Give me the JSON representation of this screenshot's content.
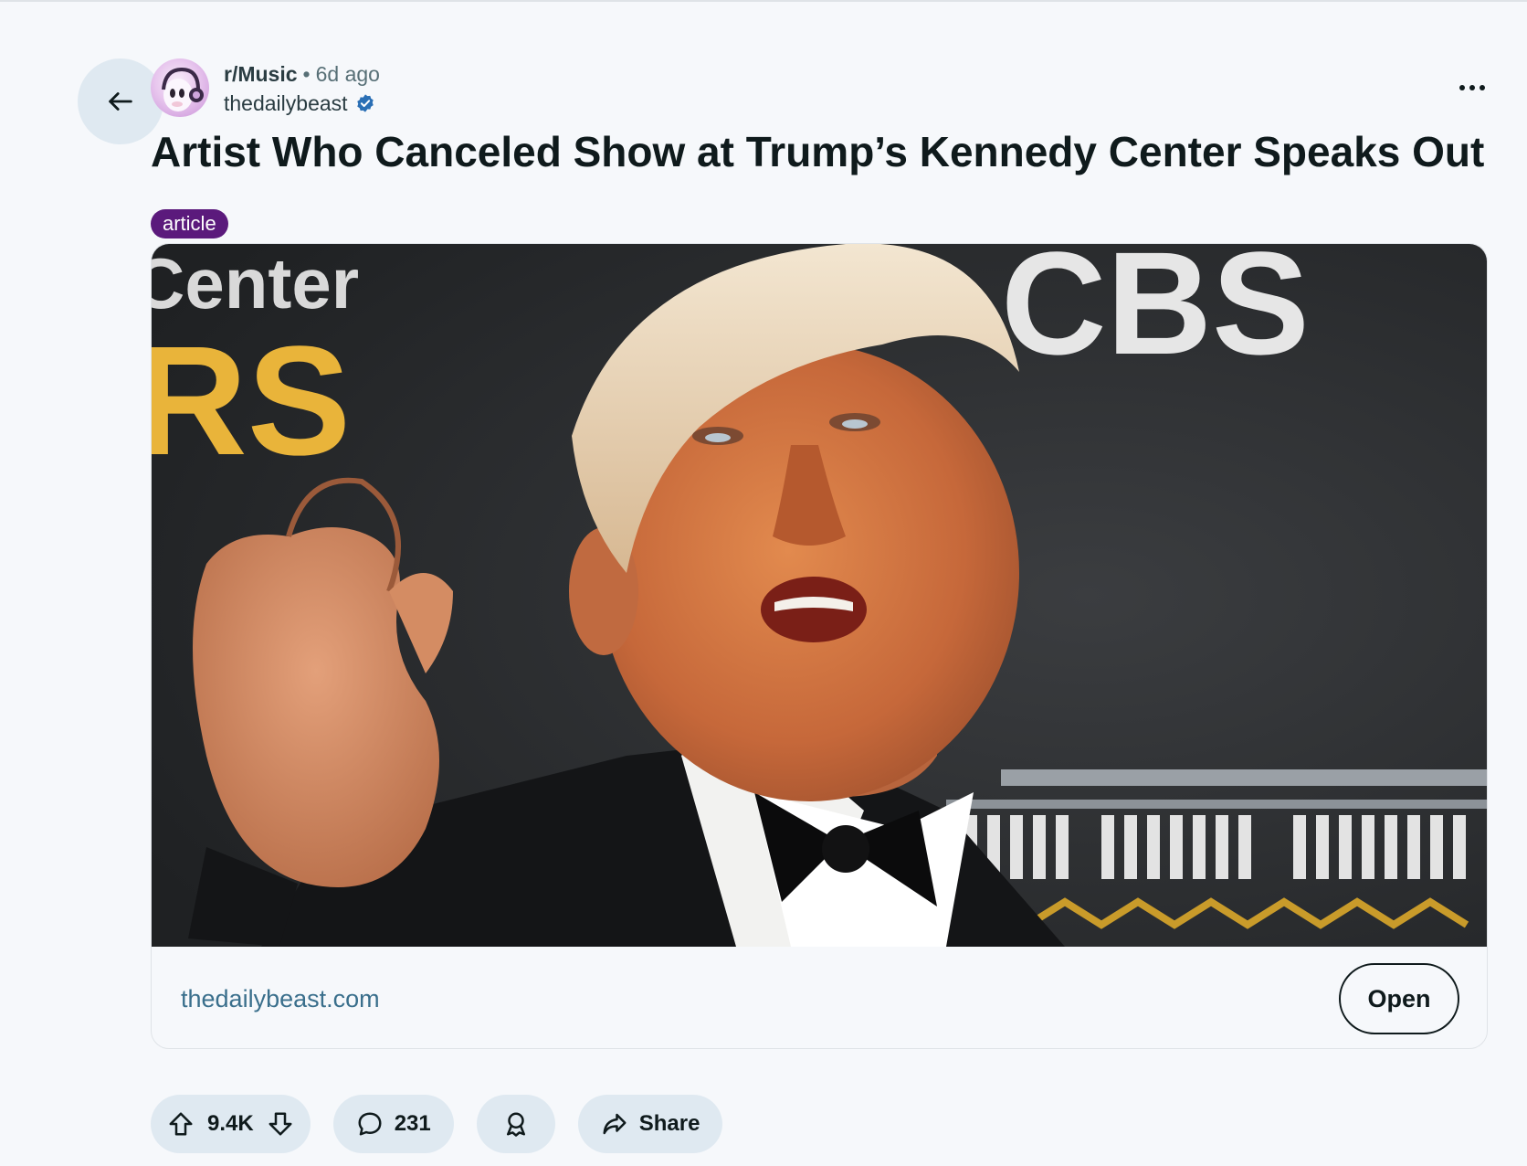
{
  "post": {
    "subreddit": "r/Music",
    "separator": "•",
    "time_ago": "6d ago",
    "author": "thedailybeast",
    "title": "Artist Who Canceled Show at Trump’s Kennedy Center Speaks Out",
    "flair": "article",
    "flair_color": "#5b1a7c"
  },
  "image": {
    "bg_text_left_top": "Center",
    "bg_text_left_big": "RS",
    "bg_text_right": "CBS"
  },
  "link": {
    "domain": "thedailybeast.com",
    "open_label": "Open"
  },
  "actions": {
    "upvotes": "9.4K",
    "comments": "231",
    "share_label": "Share"
  },
  "colors": {
    "accent_link": "#3a6f8c",
    "pill_bg": "#dfe9f1",
    "page_bg": "#f6f8fb",
    "verified": "#2a6fb5"
  },
  "icons": [
    "arrow-left-icon",
    "avatar",
    "verified-badge-icon",
    "more-horizontal-icon",
    "upvote-icon",
    "downvote-icon",
    "comment-icon",
    "award-icon",
    "share-icon"
  ]
}
